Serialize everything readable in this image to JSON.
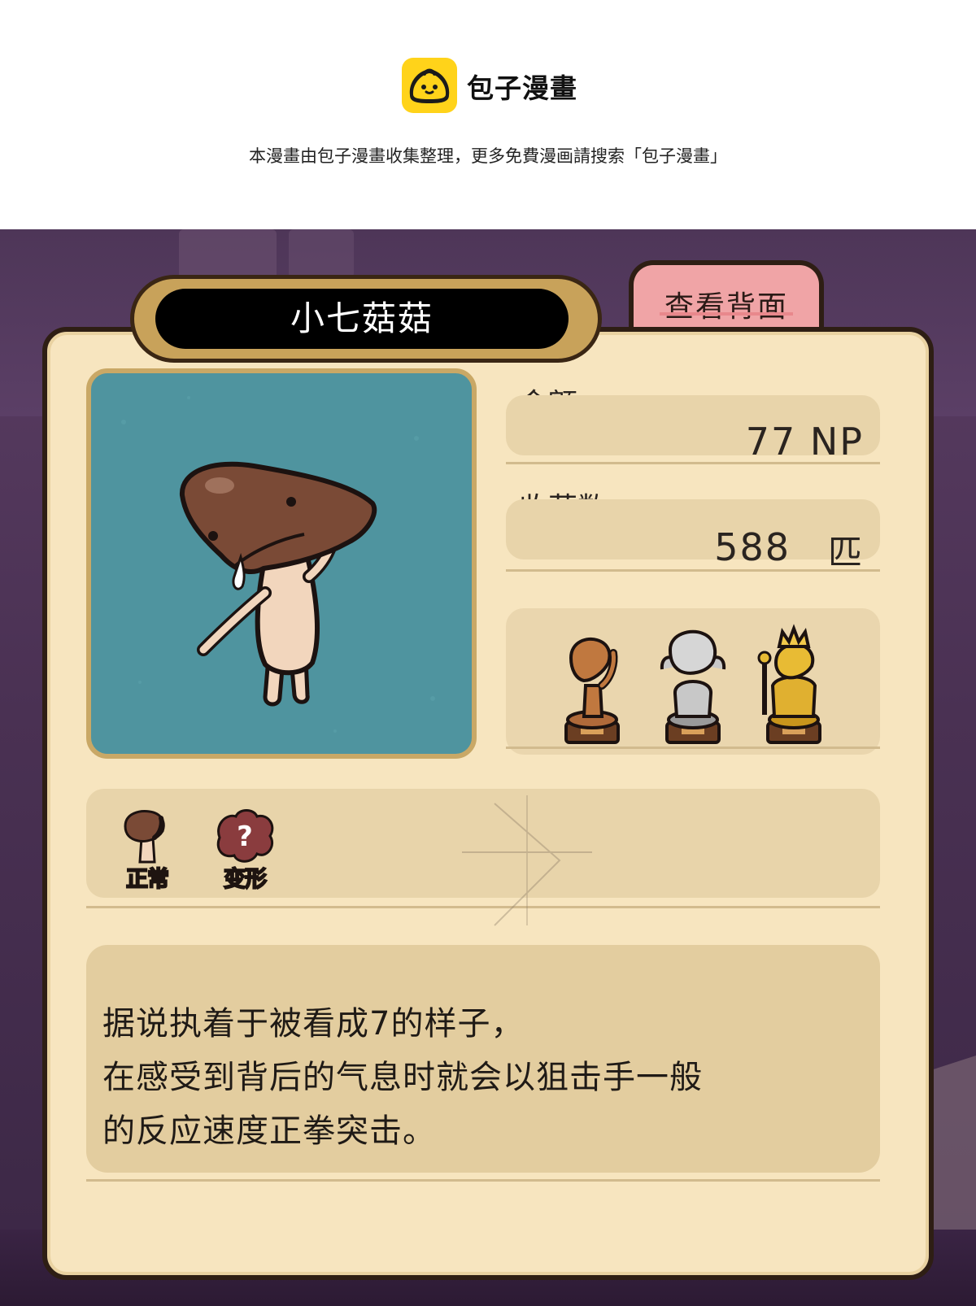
{
  "banner": {
    "site_name": "包子漫畫",
    "notice": "本漫畫由包子漫畫收集整理，更多免費漫画請搜索「包子漫畫」"
  },
  "card": {
    "title": "小七菇菇",
    "back_tab_label": "查看背面",
    "stats": {
      "money_label": "金额",
      "money_value": "77 NP",
      "harvest_label": "收获数",
      "harvest_value": "588",
      "harvest_unit": "匹"
    },
    "trophies": [
      {
        "icon": "bronze-trophy-icon"
      },
      {
        "icon": "silver-trophy-icon"
      },
      {
        "icon": "gold-trophy-icon"
      }
    ],
    "forms": [
      {
        "label": "正常",
        "icon": "normal-form-icon"
      },
      {
        "label": "变形",
        "icon": "mystery-form-icon"
      }
    ],
    "description": [
      "据说执着于被看成7的样子，",
      "在感受到背后的气息时就会以狙击手一般",
      "的反应速度正拳突击。"
    ]
  },
  "colors": {
    "logo": "#ffd31a",
    "card": "#f7e5bf",
    "portrait_bg": "#4f949f",
    "back_tab": "#f0a4a6",
    "title_plate": "#c8a25a"
  }
}
